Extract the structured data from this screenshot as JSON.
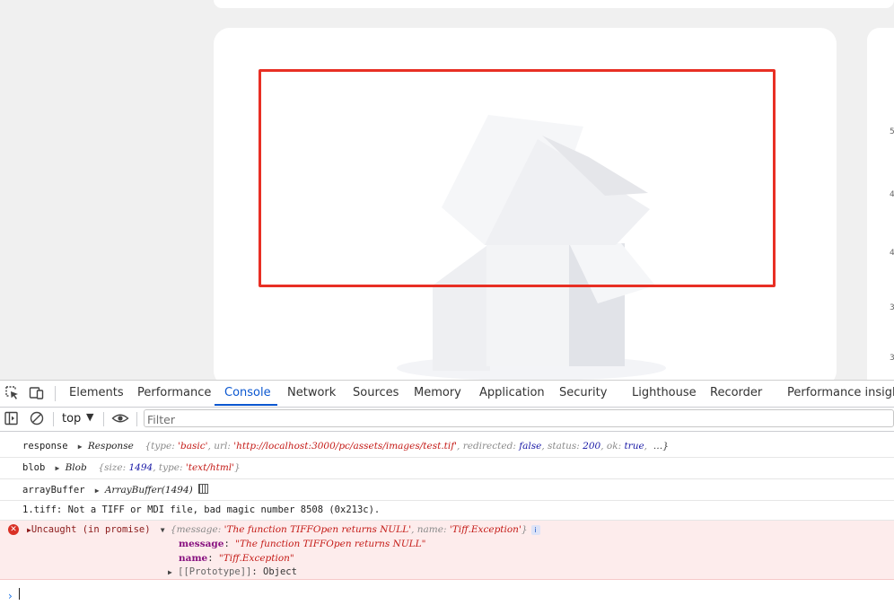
{
  "page": {
    "axis_ticks": [
      "5",
      "4",
      "4",
      "3",
      "3"
    ]
  },
  "devtools": {
    "tabs": [
      "Elements",
      "Performance",
      "Console",
      "Network",
      "Sources",
      "Memory",
      "Application",
      "Security",
      "Lighthouse",
      "Recorder",
      "Performance insights"
    ],
    "active_tab": "Console",
    "context": "top",
    "filter_placeholder": "Filter"
  },
  "console": {
    "response": {
      "label": "response",
      "type": "Response",
      "open": "{",
      "k_type": "type",
      "v_type": "'basic'",
      "k_url": "url",
      "v_url": "'http://localhost:3000/pc/assets/images/test.tif'",
      "k_redirected": "redirected",
      "v_redirected": "false",
      "k_status": "status",
      "v_status": "200",
      "k_ok": "ok",
      "v_ok": "true",
      "more": "…}"
    },
    "blob": {
      "label": "blob",
      "type": "Blob",
      "open": "{",
      "k_size": "size",
      "v_size": "1494",
      "k_type": "type",
      "v_type": "'text/html'",
      "close": "}"
    },
    "arraybuffer": {
      "label": "arrayBuffer",
      "value": "ArrayBuffer(1494)"
    },
    "message": "1.tiff: Not a TIFF or MDI file, bad magic number 8508 (0x213c).",
    "error": {
      "prefix": "Uncaught (in promise)",
      "summary_open": "{",
      "k_message": "message",
      "v_message": "'The function TIFFOpen returns NULL'",
      "k_name": "name",
      "v_name": "'Tiff.Exception'",
      "summary_close": "}",
      "info": "i",
      "expanded_message_key": "message",
      "expanded_message_value": "\"The function TIFFOpen returns NULL\"",
      "expanded_name_key": "name",
      "expanded_name_value": "\"Tiff.Exception\"",
      "prototype_key": "[[Prototype]]",
      "prototype_value": "Object"
    }
  }
}
